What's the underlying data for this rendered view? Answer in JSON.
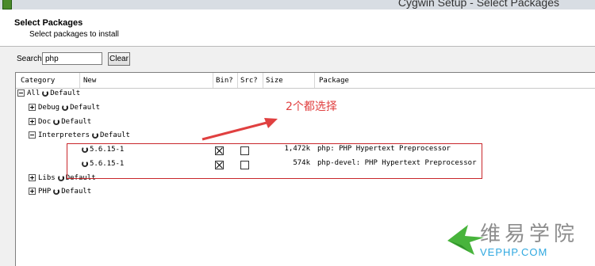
{
  "window": {
    "title": "Cygwin Setup - Select Packages"
  },
  "header": {
    "title": "Select Packages",
    "subtitle": "Select packages to install"
  },
  "search": {
    "label": "Search",
    "value": "php",
    "clear_label": "Clear"
  },
  "columns": [
    "Category",
    "New",
    "Bin?",
    "Src?",
    "Size",
    "Package"
  ],
  "tree": {
    "all": {
      "label": "All",
      "action": "Default"
    },
    "debug": {
      "label": "Debug",
      "action": "Default"
    },
    "doc": {
      "label": "Doc",
      "action": "Default"
    },
    "interpreters": {
      "label": "Interpreters",
      "action": "Default"
    },
    "libs": {
      "label": "Libs",
      "action": "Default"
    },
    "php": {
      "label": "PHP",
      "action": "Default"
    }
  },
  "packages": [
    {
      "version": "5.6.15-1",
      "bin": true,
      "src": false,
      "size": "1,472k",
      "package": "php: PHP Hypertext Preprocessor"
    },
    {
      "version": "5.6.15-1",
      "bin": true,
      "src": false,
      "size": "574k",
      "package": "php-devel: PHP Hypertext Preprocessor"
    }
  ],
  "annotation": {
    "text": "2个都选择",
    "color": "#e04040"
  },
  "watermark": {
    "chinese": "维易学院",
    "english": "VEPHP.COM",
    "accent": "#2fa8e0"
  },
  "colors": {
    "highlight": "#c8262b"
  }
}
